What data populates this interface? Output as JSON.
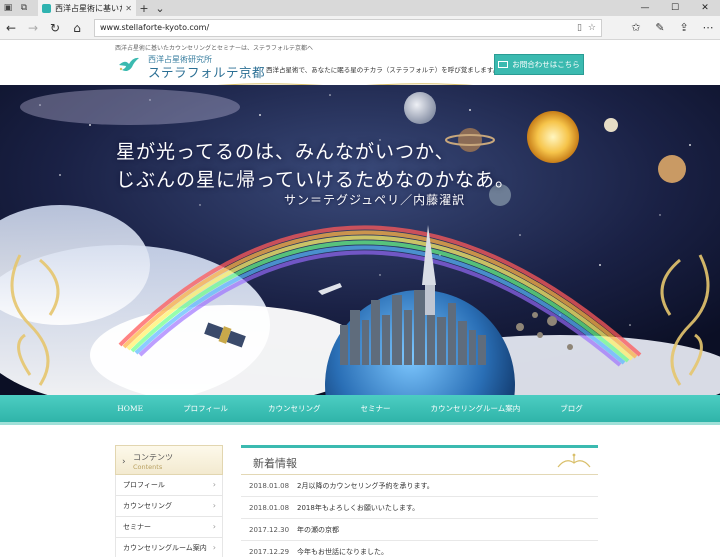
{
  "browser": {
    "tab_title": "西洋占星術に基いたカウン",
    "url": "www.stellaforte-kyoto.com/"
  },
  "header": {
    "tagline": "西洋占星術に基いたカウンセリングとセミナーは、ステラフォルテ京都へ",
    "logo_sub": "西洋占星術研究所",
    "logo_main": "ステラフォルテ京都",
    "description": "西洋占星術で、あなたに眠る星のチカラ（ステラフォルテ）を呼び覚まします。",
    "contact_label": "お問合わせはこちら"
  },
  "hero": {
    "quote_line1": "星が光ってるのは、みんながいつか、",
    "quote_line2": "じぶんの星に帰っていけるためなのかなあ。",
    "author": "サン＝テグジュペリ／内藤濯訳"
  },
  "global_nav": [
    "HOME",
    "プロフィール",
    "カウンセリング",
    "セミナー",
    "カウンセリングルーム案内",
    "ブログ"
  ],
  "sidebar": {
    "heading": "コンテンツ",
    "heading_en": "Contents",
    "items": [
      "プロフィール",
      "カウンセリング",
      "セミナー",
      "カウンセリングルーム案内"
    ]
  },
  "news": {
    "title": "新着情報",
    "items": [
      {
        "date": "2018.01.08",
        "text": "2月以降のカウンセリング予約を承ります。"
      },
      {
        "date": "2018.01.08",
        "text": "2018年もよろしくお願いいたします。"
      },
      {
        "date": "2017.12.30",
        "text": "年の瀬の京都"
      },
      {
        "date": "2017.12.29",
        "text": "今年もお世話になりました。"
      }
    ]
  },
  "colors": {
    "teal": "#3bbab0",
    "navy": "#2b6f94",
    "gold": "#d9bf6a"
  }
}
